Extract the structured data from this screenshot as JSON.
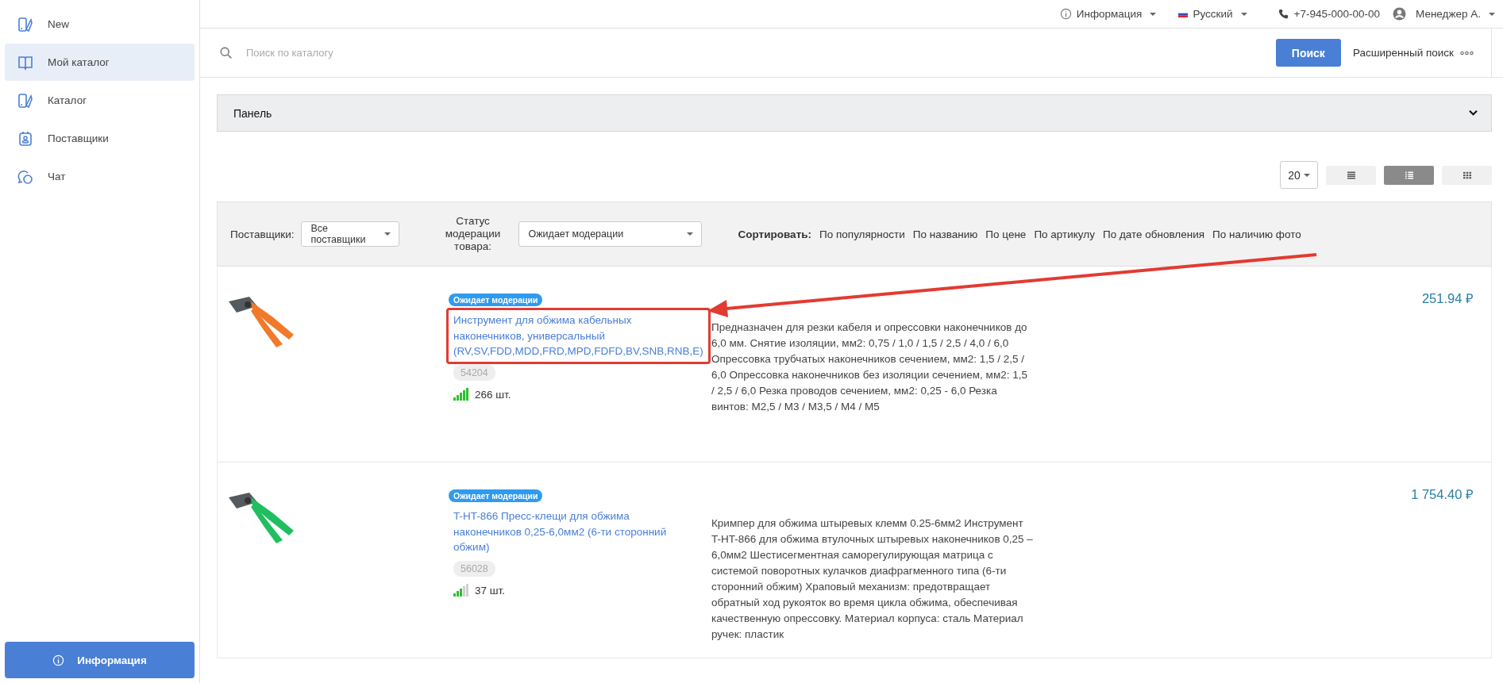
{
  "sidebar": {
    "items": [
      {
        "label": "New",
        "selected": false
      },
      {
        "label": "Мой каталог",
        "selected": true
      },
      {
        "label": "Каталог",
        "selected": false
      },
      {
        "label": "Поставщики",
        "selected": false
      },
      {
        "label": "Чат",
        "selected": false
      }
    ],
    "info_button": "Информация"
  },
  "topbar": {
    "info": "Информация",
    "language": "Русский",
    "phone": "+7-945-000-00-00",
    "user": "Менеджер А."
  },
  "search": {
    "placeholder": "Поиск по каталогу",
    "button": "Поиск",
    "advanced": "Расширенный поиск"
  },
  "panel": {
    "title": "Панель",
    "expanded": false
  },
  "view": {
    "per_page": "20",
    "modes": [
      {
        "kind": "list",
        "selected": false
      },
      {
        "kind": "table",
        "selected": true
      },
      {
        "kind": "grid",
        "selected": false
      }
    ]
  },
  "filters": {
    "suppliers_label": "Поставщики:",
    "suppliers_value": "Все поставщики",
    "status_label": "Статус модерации товара:",
    "status_value": "Ожидает модерации",
    "sort_label": "Сортировать:",
    "sort_options": [
      "По популярности",
      "По названию",
      "По цене",
      "По артикулу",
      "По дате обновления",
      "По наличию фото"
    ]
  },
  "products": [
    {
      "badge": "Ожидает модерации",
      "title": "Инструмент для обжима кабельных наконечников, универсальный (RV,SV,FDD,MDD,FRD,MPD,FDFD,BV,SNB,RNB,E)",
      "highlighted": true,
      "sku": "54204",
      "level": 1,
      "stock": "266 шт.",
      "description": "Предназначен для резки кабеля и опрессовки наконечников до 6,0 мм. Снятие изоляции, мм2: 0,75 / 1,0 / 1,5 / 2,5 / 4,0 / 6,0 Опрессовка трубчатых наконечников сечением, мм2: 1,5 / 2,5 / 6,0 Опрессовка наконечников без изоляции сечением, мм2: 1,5 / 2,5 / 6,0 Резка проводов сечением, мм2: 0,25 - 6,0 Резка винтов: М2,5 / М3 / М3,5 / М4 / М5",
      "price": "251.94 ₽"
    },
    {
      "badge": "Ожидает модерации",
      "title": "T-HT-866 Пресс-клещи для обжима наконечников 0,25-6,0мм2 (6-ти сторонний обжим)",
      "highlighted": false,
      "sku": "56028",
      "level": 0.6,
      "stock": "37 шт.",
      "description": "Кримпер для обжима штыревых клемм 0.25-6мм2 Инструмент T-HT-866 для обжима втулочных штыревых наконечников 0,25 – 6,0мм2 Шестисегментная саморегулирующая матрица с системой поворотных кулачков диафрагменного типа (6-ти сторонний обжим) Храповый механизм: предотвращает обратный ход рукояток во время цикла обжима, обеспечивая качественную опрессовку. Материал корпуса: сталь Материал ручек: пластик",
      "price": "1 754.40 ₽"
    }
  ]
}
